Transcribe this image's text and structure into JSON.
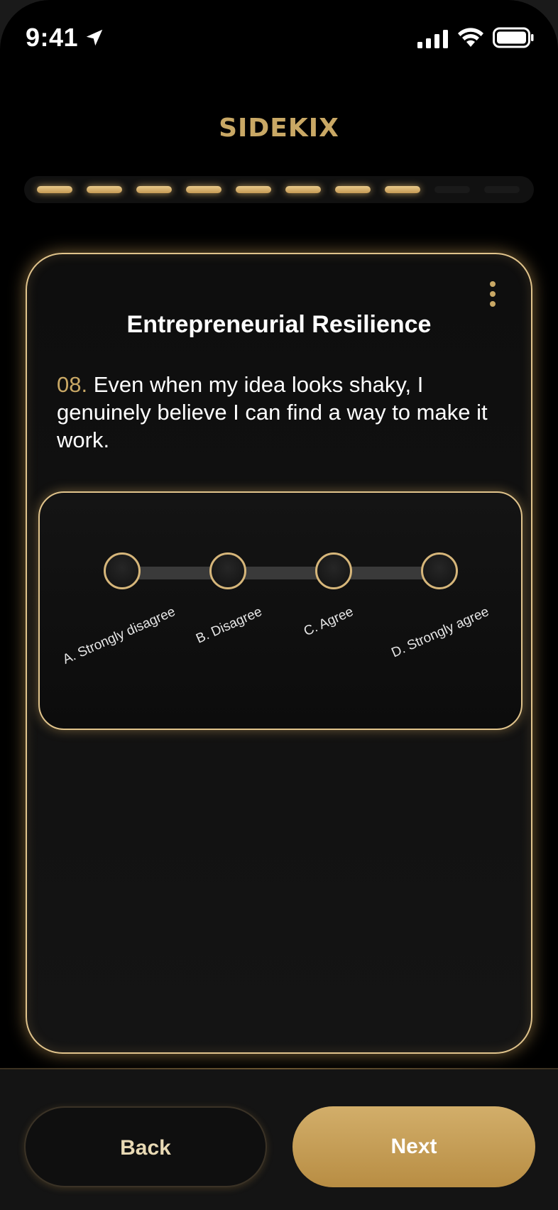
{
  "status_bar": {
    "time": "9:41",
    "icons": [
      "location-arrow-icon",
      "signal-icon",
      "wifi-icon",
      "battery-icon"
    ]
  },
  "logo": {
    "text": "SIDEKIX"
  },
  "progress": {
    "total_steps": 10,
    "completed_steps": 8
  },
  "card": {
    "title": "Entrepreneurial Resilience",
    "question_number": "08.",
    "question_text": "Even when my idea looks shaky, I genuinely believe I can find a way to make it work.",
    "menu_icon": "more-vertical-icon"
  },
  "scale": {
    "options": [
      {
        "label": "A. Strongly disagree"
      },
      {
        "label": "B. Disagree"
      },
      {
        "label": "C. Agree"
      },
      {
        "label": "D. Strongly agree"
      }
    ]
  },
  "actions": {
    "back_label": "Back",
    "next_label": "Next"
  },
  "colors": {
    "accent": "#c9a865",
    "background": "#000000",
    "next_button": "#c49a52"
  }
}
